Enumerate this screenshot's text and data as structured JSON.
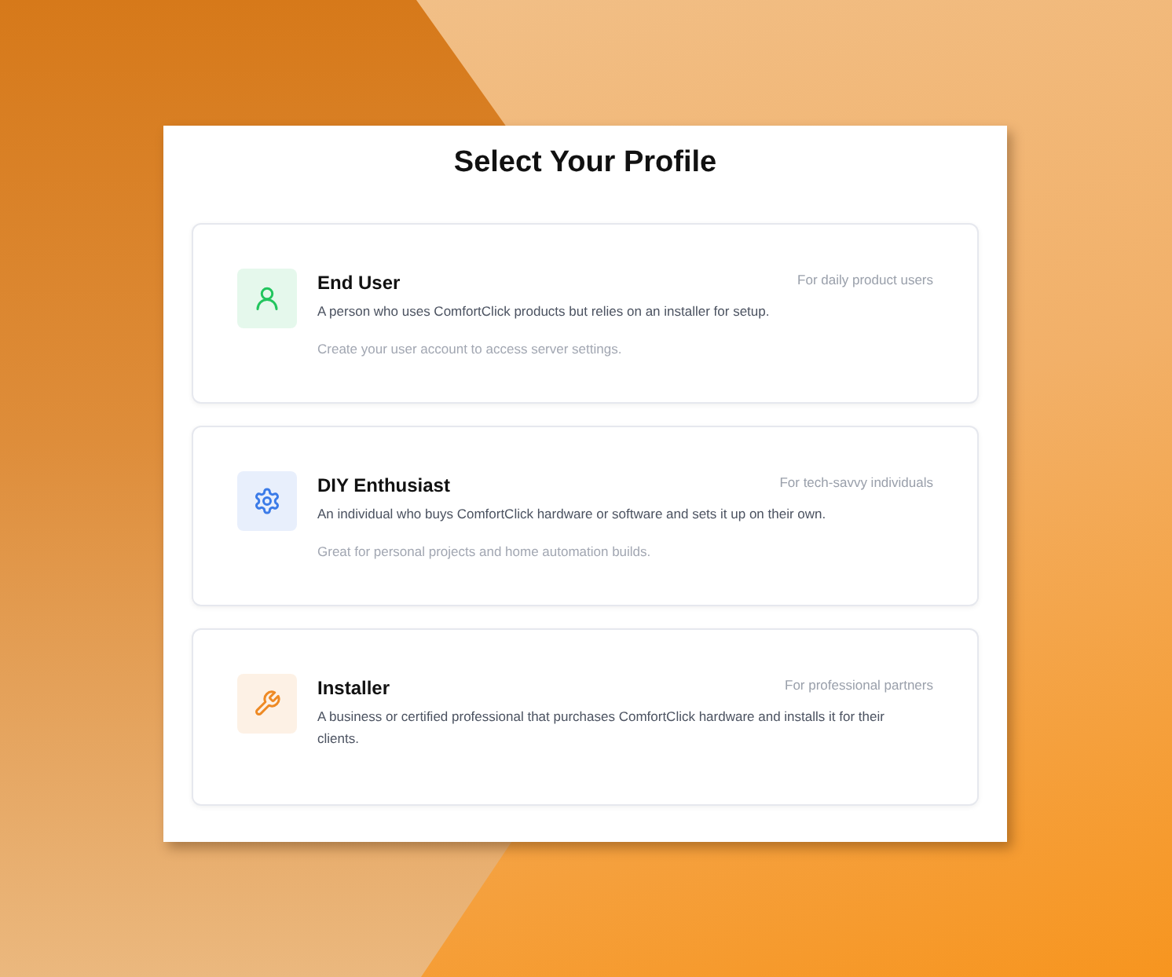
{
  "title": "Select Your Profile",
  "profiles": [
    {
      "kind": "user",
      "name": "End User",
      "audience": "For daily product users",
      "description": "A person who uses ComfortClick products but relies on an installer for setup.",
      "note": "Create your user account to access server settings.",
      "color": "#22c55e"
    },
    {
      "kind": "enthusiast",
      "name": "DIY Enthusiast",
      "audience": "For tech-savvy individuals",
      "description": "An individual who buys ComfortClick hardware or software and sets it up on their own.",
      "note": "Great for personal projects and home automation builds.",
      "color": "#3b7be8"
    },
    {
      "kind": "installer",
      "name": "Installer",
      "audience": "For professional partners",
      "description": "A business or certified professional that purchases ComfortClick hardware and installs it for their clients.",
      "color": "#ee8a25"
    }
  ]
}
